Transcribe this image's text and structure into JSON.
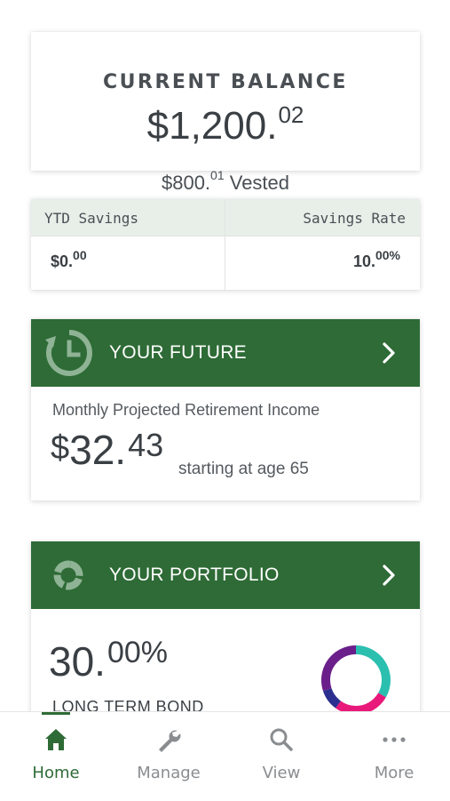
{
  "balance": {
    "title": "CURRENT BALANCE",
    "amount_main": "$1,200.",
    "amount_cents": "02",
    "vested_main": "$800.",
    "vested_cents": "01",
    "vested_label": " Vested"
  },
  "stats": {
    "ytd_label": "YTD Savings",
    "ytd_main": "$0.",
    "ytd_cents": "00",
    "rate_label": "Savings Rate",
    "rate_main": "10.",
    "rate_cents": "00%"
  },
  "future": {
    "title": "YOUR FUTURE",
    "subtitle": "Monthly Projected Retirement Income",
    "dollar": "$",
    "amount_main": "32.",
    "amount_cents": "43",
    "age_text": "starting at age 65",
    "icon": "clock-history-icon"
  },
  "portfolio": {
    "title": "YOUR PORTFOLIO",
    "pct_main": "30.",
    "pct_cents": "00%",
    "asset_label": "LONG TERM BOND",
    "icon": "portfolio-ring-icon",
    "donut_colors": [
      "#2bbfb0",
      "#e8197a",
      "#2b2f8f",
      "#6a1f8a"
    ]
  },
  "nav": {
    "items": [
      {
        "label": "Home",
        "icon": "home-icon",
        "active": true
      },
      {
        "label": "Manage",
        "icon": "wrench-icon",
        "active": false
      },
      {
        "label": "View",
        "icon": "search-icon",
        "active": false
      },
      {
        "label": "More",
        "icon": "more-dots-icon",
        "active": false
      }
    ]
  },
  "colors": {
    "brand_green": "#2e6b36",
    "stats_header_bg": "#e8efe9",
    "nav_inactive": "#8a8d90"
  }
}
